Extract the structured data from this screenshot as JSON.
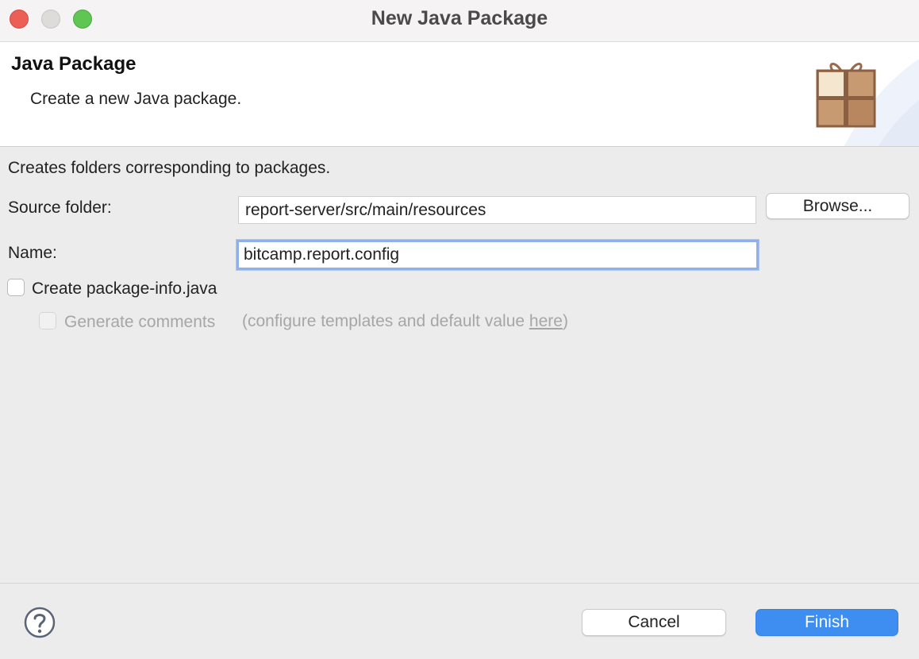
{
  "window": {
    "title": "New Java Package"
  },
  "banner": {
    "title": "Java Package",
    "description": "Create a new Java package."
  },
  "form": {
    "intro": "Creates folders corresponding to packages.",
    "source_folder_label": "Source folder:",
    "source_folder_value": "report-server/src/main/resources",
    "browse_label": "Browse...",
    "name_label": "Name:",
    "name_value": "bitcamp.report.config",
    "create_package_info_label": "Create package-info.java",
    "create_package_info_checked": false,
    "generate_comments_label": "Generate comments",
    "generate_comments_checked": false,
    "generate_comments_enabled": false,
    "templates_hint_prefix": "(configure templates and default value ",
    "templates_hint_link": "here",
    "templates_hint_suffix": ")"
  },
  "footer": {
    "cancel_label": "Cancel",
    "finish_label": "Finish"
  },
  "icons": {
    "help": "help-icon",
    "package": "package-icon"
  },
  "colors": {
    "accent": "#3d8ef0",
    "focus_ring": "#8fb0ea",
    "close": "#ec5f57",
    "maximize": "#5fc553"
  }
}
